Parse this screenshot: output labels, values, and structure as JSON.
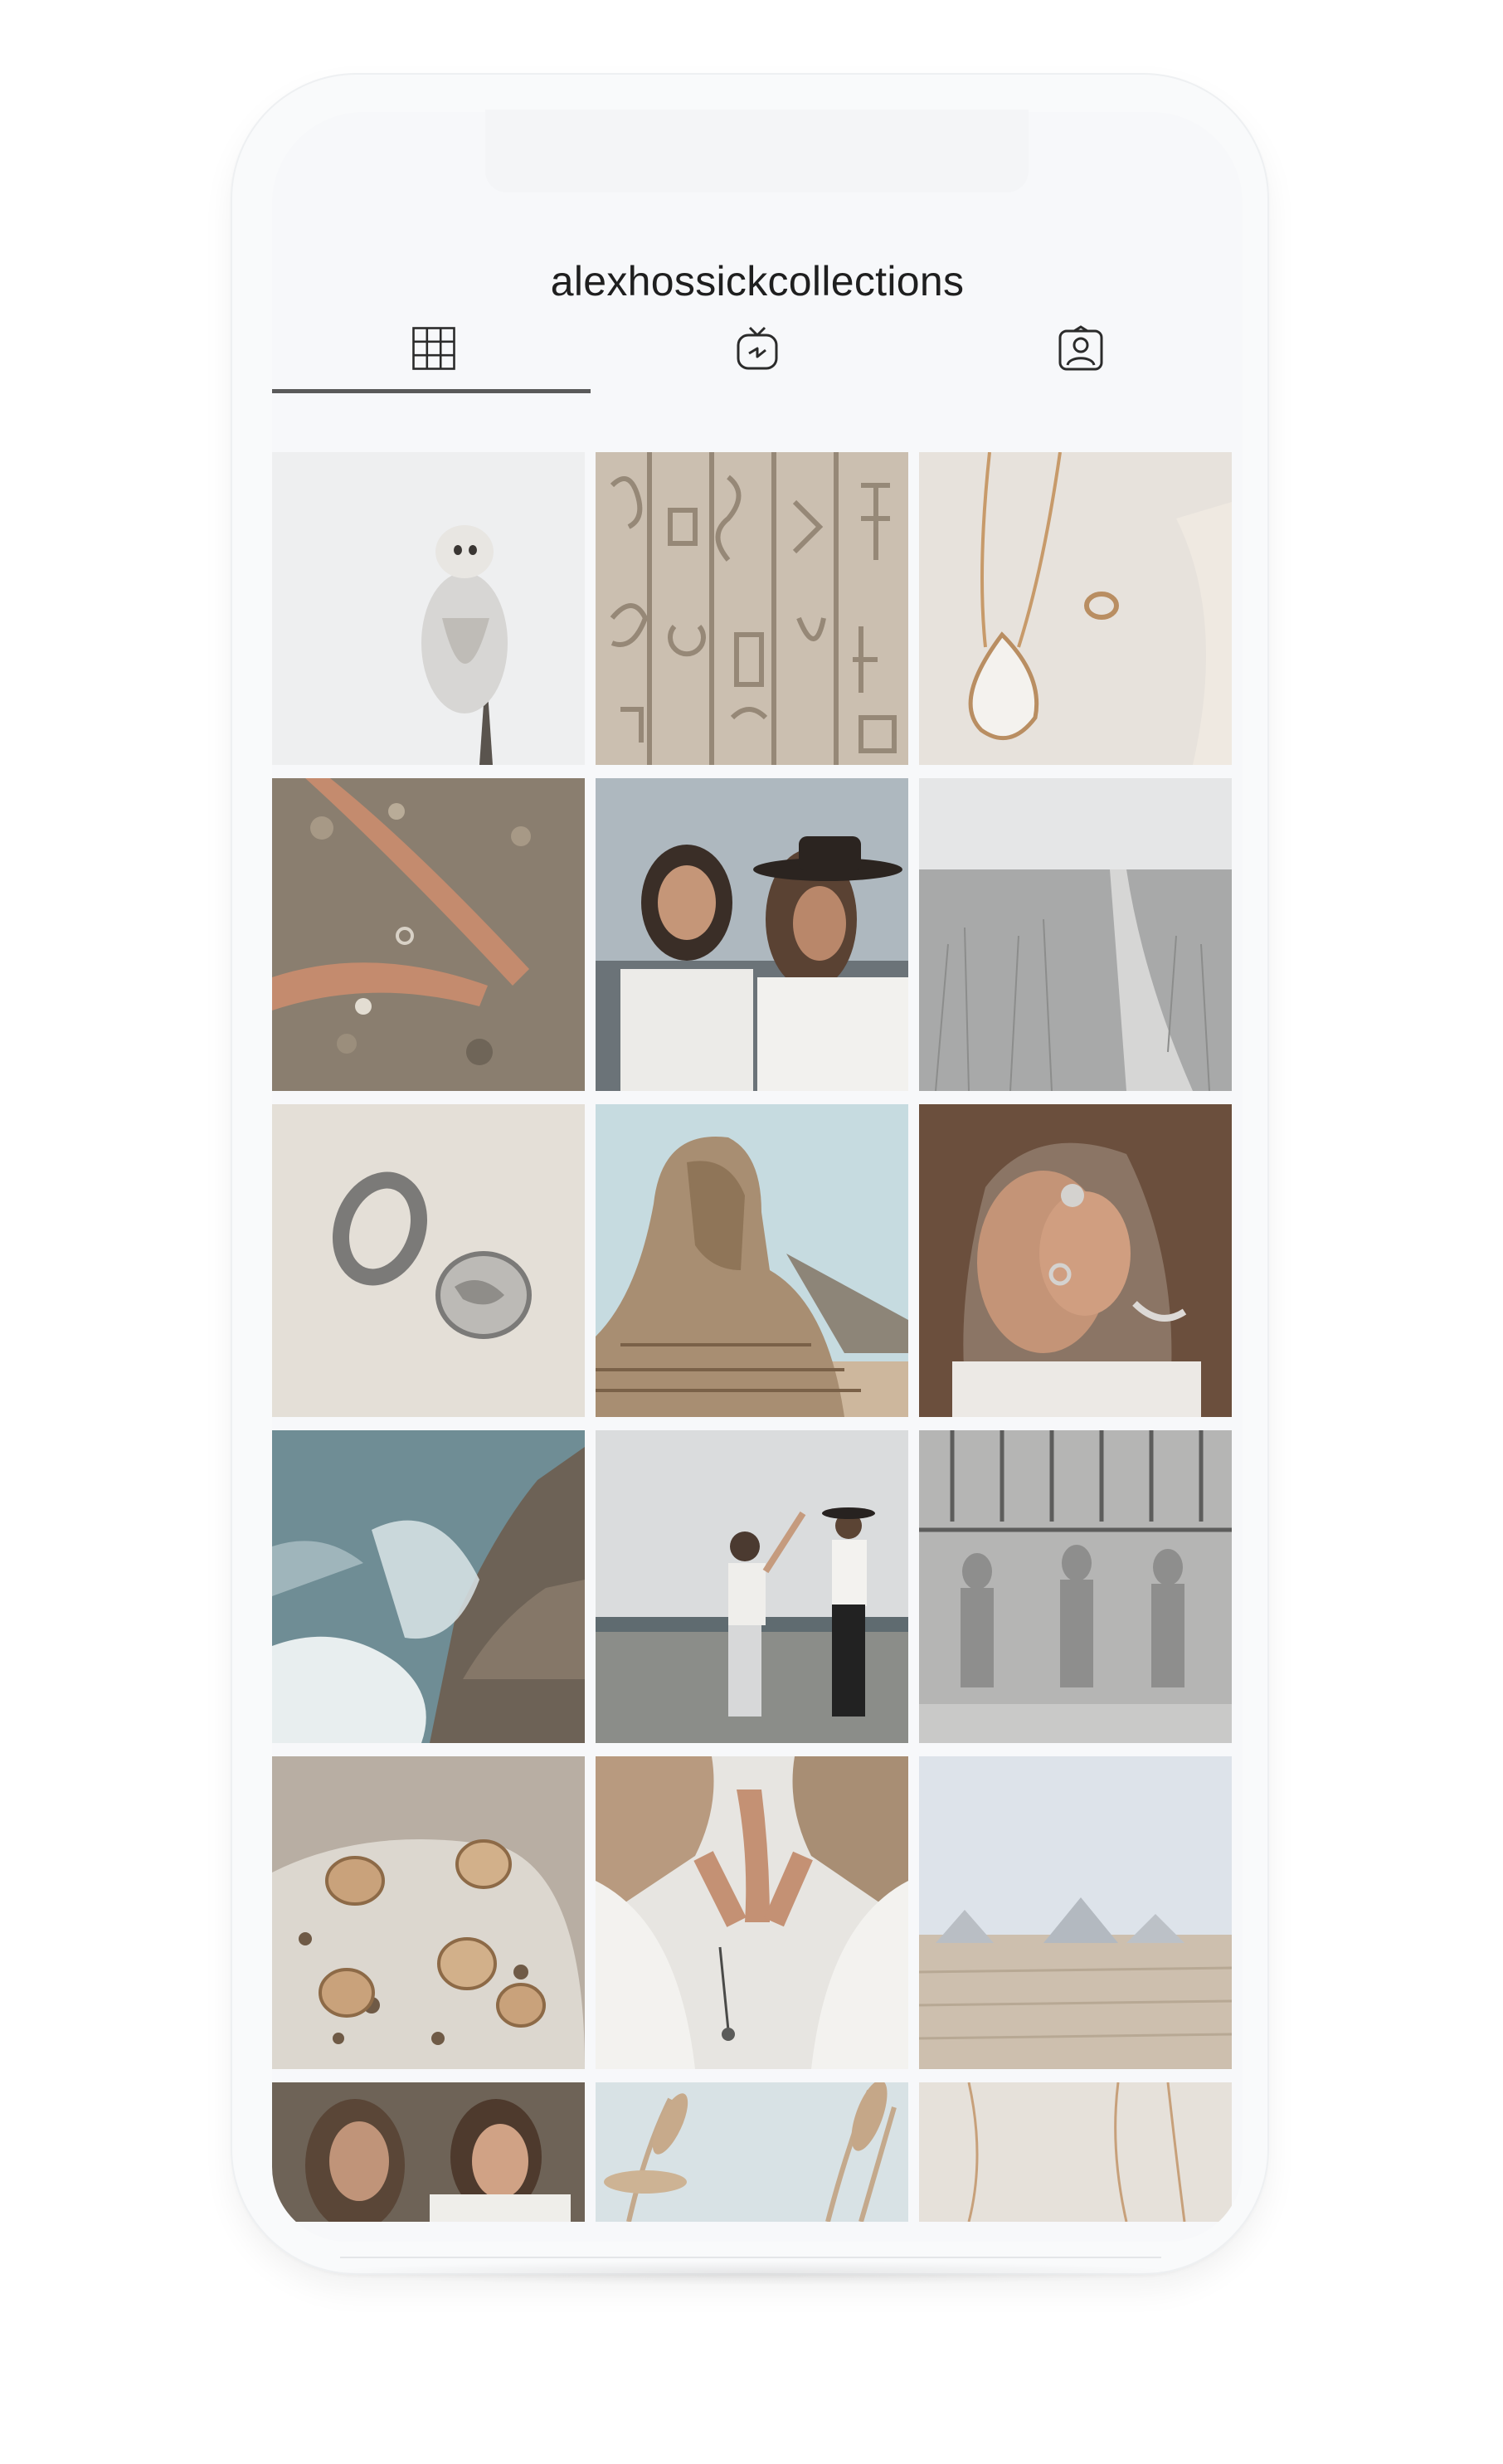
{
  "profile": {
    "username": "alexhossickcollections"
  },
  "tabs": [
    {
      "name": "grid-tab",
      "icon": "grid-icon",
      "selected": true
    },
    {
      "name": "igtv-tab",
      "icon": "igtv-icon",
      "selected": false
    },
    {
      "name": "tagged-tab",
      "icon": "tagged-person-icon",
      "selected": false
    }
  ],
  "colors": {
    "underline": "#5a5a5a",
    "icon": "#2b2b2b",
    "background": "#f7f8fa"
  },
  "posts": [
    {
      "subject": "barn-owl"
    },
    {
      "subject": "hieroglyph-wall"
    },
    {
      "subject": "gold-pendant-and-ring"
    },
    {
      "subject": "hands-with-rings-on-rock"
    },
    {
      "subject": "couple-by-sea"
    },
    {
      "subject": "grass-field-path"
    },
    {
      "subject": "silver-signet-rings"
    },
    {
      "subject": "sphinx"
    },
    {
      "subject": "man-with-ring"
    },
    {
      "subject": "ocean-waves-on-rocks"
    },
    {
      "subject": "couple-dancing-on-beach"
    },
    {
      "subject": "egyptian-relief"
    },
    {
      "subject": "gold-rings-on-stone"
    },
    {
      "subject": "hands-praying"
    },
    {
      "subject": "pyramids-desert"
    },
    {
      "subject": "two-women"
    },
    {
      "subject": "pampas-grass"
    },
    {
      "subject": "gold-chain"
    }
  ]
}
